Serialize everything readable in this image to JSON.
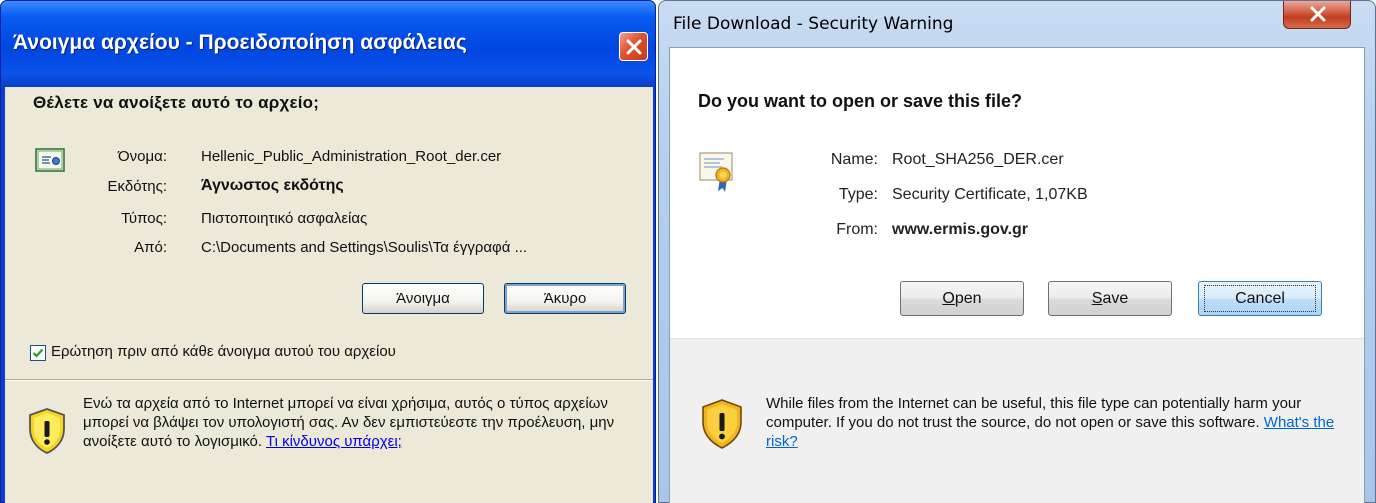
{
  "xp_dialog": {
    "title": "Άνοιγμα αρχείου - Προειδοποίηση ασφάλειας",
    "question": "Θέλετε να ανοίξετε αυτό το αρχείο;",
    "fields": [
      {
        "label": "Όνομα:",
        "value": "Hellenic_Public_Administration_Root_der.cer"
      },
      {
        "label": "Εκδότης:",
        "value": "Άγνωστος εκδότης"
      },
      {
        "label": "Τύπος:",
        "value": "Πιστοποιητικό ασφαλείας"
      },
      {
        "label": "Από:",
        "value": "C:\\Documents and Settings\\Soulis\\Τα έγγραφά ..."
      }
    ],
    "open_button": "Άνοιγμα",
    "cancel_button": "Άκυρο",
    "checkbox_label": "Ερώτηση πριν από κάθε άνοιγμα αυτού του αρχείου",
    "checkbox_checked": true,
    "warning_text": "Ενώ τα αρχεία από το Internet μπορεί να είναι χρήσιμα, αυτός ο τύπος αρχείων μπορεί να βλάψει τον υπολογιστή σας. Αν δεν εμπιστεύεστε την προέλευση, μην ανοίξετε αυτό το λογισμικό.",
    "warning_link": "Τι κίνδυνος υπάρχει;",
    "colors": {
      "title_bar": "#0a5cf0",
      "body": "#ece9d8",
      "close": "#e0532f",
      "link": "#0000ee"
    },
    "icons": [
      "close-icon",
      "certificate-icon",
      "checkmark-icon",
      "shield-warning-icon"
    ]
  },
  "win7_dialog": {
    "title": "File Download - Security Warning",
    "question": "Do you want to open or save this file?",
    "fields": [
      {
        "label": "Name:",
        "value": "Root_SHA256_DER.cer"
      },
      {
        "label": "Type:",
        "value": "Security Certificate, 1,07KB"
      },
      {
        "label": "From:",
        "value": "www.ermis.gov.gr"
      }
    ],
    "open_button": {
      "mnemonic": "O",
      "rest": "pen"
    },
    "save_button": {
      "mnemonic": "S",
      "rest": "ave"
    },
    "cancel_button": "Cancel",
    "warning_text": "While files from the Internet can be useful, this file type can potentially harm your computer. If you do not trust the source, do not open or save this software.",
    "warning_link": "What's the risk?",
    "colors": {
      "frame": "#b6cfee",
      "body": "#f0f0f0",
      "close": "#c23d20",
      "link": "#0066cc"
    },
    "icons": [
      "close-icon",
      "certificate-icon",
      "shield-warning-icon"
    ]
  }
}
